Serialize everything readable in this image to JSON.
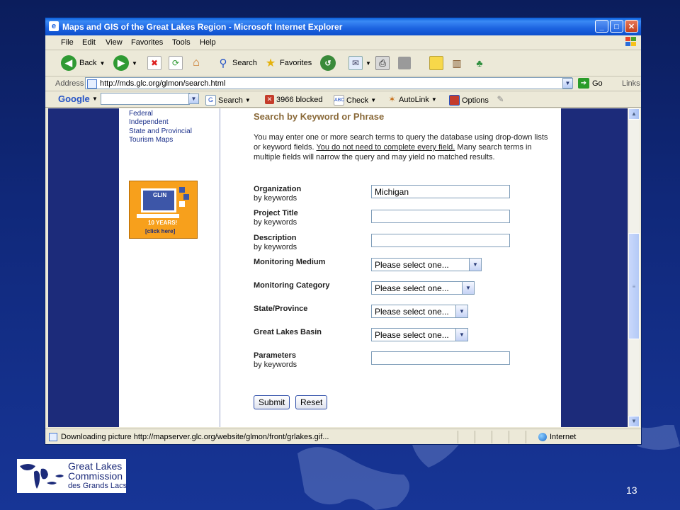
{
  "browser": {
    "window_title": "Maps and GIS of the Great Lakes Region - Microsoft Internet Explorer",
    "menu": [
      "File",
      "Edit",
      "View",
      "Favorites",
      "Tools",
      "Help"
    ],
    "toolbar": {
      "back": "Back",
      "search": "Search",
      "favorites": "Favorites"
    },
    "address": {
      "label": "Address",
      "url": "http://mds.glc.org/glmon/search.html",
      "go": "Go",
      "links": "Links"
    },
    "google_toolbar": {
      "logo": "Google",
      "search": "Search",
      "blocked": "3966 blocked",
      "check": "Check",
      "autolink": "AutoLink",
      "options": "Options"
    },
    "status": {
      "text": "Downloading picture http://mapserver.glc.org/website/glmon/front/grlakes.gif...",
      "zone": "Internet"
    }
  },
  "page": {
    "nav_links": [
      "Federal",
      "Independent",
      "State and Provincial",
      "Tourism Maps"
    ],
    "badge": {
      "line1": "GLIN",
      "line2": "10 YEARS!",
      "line3": "[click here]"
    },
    "heading": "Search by Keyword or Phrase",
    "intro_a": "You may enter one or more search terms to query the database using drop-down lists or keyword fields. ",
    "intro_u": "You do not need to complete every field.",
    "intro_b": " Many search terms in multiple fields will narrow the query and may yield no matched results.",
    "fields": {
      "organization": {
        "label": "Organization",
        "sub": "by keywords",
        "value": "Michigan"
      },
      "project_title": {
        "label": "Project Title",
        "sub": "by keywords",
        "value": ""
      },
      "description": {
        "label": "Description",
        "sub": "by keywords",
        "value": ""
      },
      "monitoring_medium": {
        "label": "Monitoring Medium",
        "value": "Please select one..."
      },
      "monitoring_category": {
        "label": "Monitoring Category",
        "value": "Please select one..."
      },
      "state_province": {
        "label": "State/Province",
        "value": "Please select one..."
      },
      "great_lakes_basin": {
        "label": "Great Lakes Basin",
        "value": "Please select one..."
      },
      "parameters": {
        "label": "Parameters",
        "sub": "by keywords",
        "value": ""
      }
    },
    "submit": "Submit",
    "reset": "Reset"
  },
  "slide": {
    "logo_line1": "Great Lakes",
    "logo_line2": "Commission",
    "logo_line3": "des Grands Lacs",
    "page_number": "13"
  }
}
